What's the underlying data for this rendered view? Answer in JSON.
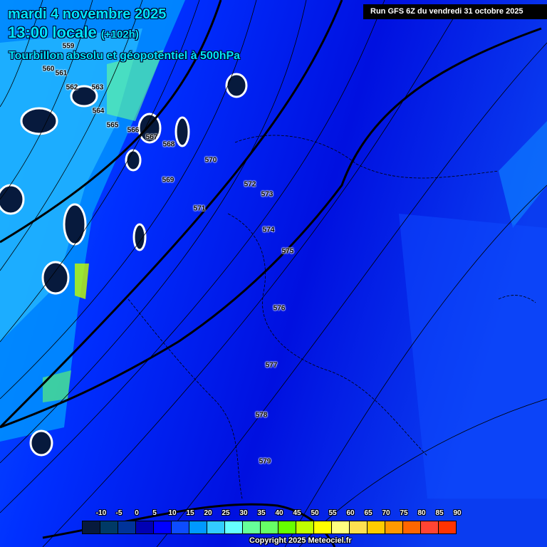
{
  "header": {
    "date": "mardi 4 novembre 2025",
    "time": "13:00 locale",
    "lead": "(+102h)",
    "parameter": "Tourbillon absolu et géopotentiel à 500hPa"
  },
  "run_label": "Run GFS 6Z du vendredi 31 octobre 2025",
  "contour_labels": [
    "559",
    "560",
    "561",
    "562",
    "563",
    "564",
    "565",
    "566",
    "567",
    "568",
    "569",
    "570",
    "571",
    "572",
    "573",
    "574",
    "575",
    "576",
    "577",
    "578",
    "579"
  ],
  "legend": {
    "ticks": [
      "-10",
      "-5",
      "0",
      "5",
      "10",
      "15",
      "20",
      "25",
      "30",
      "35",
      "40",
      "45",
      "50",
      "55",
      "60",
      "65",
      "70",
      "75",
      "80",
      "85",
      "90"
    ],
    "colors": [
      "#071a3d",
      "#003a66",
      "#003399",
      "#0000b4",
      "#0000ff",
      "#0d4cff",
      "#0099ff",
      "#33ccff",
      "#66ffff",
      "#66ff99",
      "#66ff66",
      "#66ff00",
      "#c0ff00",
      "#ffff00",
      "#ffff80",
      "#ffe050",
      "#ffcc00",
      "#ff9900",
      "#ff6600",
      "#ff4433",
      "#ff3300"
    ]
  },
  "copyright": "Copyright 2025 Meteociel.fr"
}
